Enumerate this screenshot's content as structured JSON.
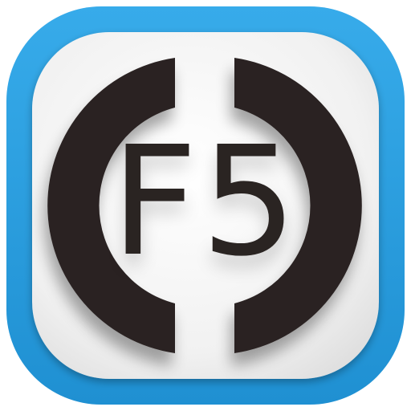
{
  "app_icon": {
    "label": "F5",
    "colors": {
      "frame": "#2aa1e3",
      "frame_dark": "#1e8fd0",
      "panel": "#efefef",
      "ring": "#2a2422",
      "text": "#2a2422"
    }
  }
}
